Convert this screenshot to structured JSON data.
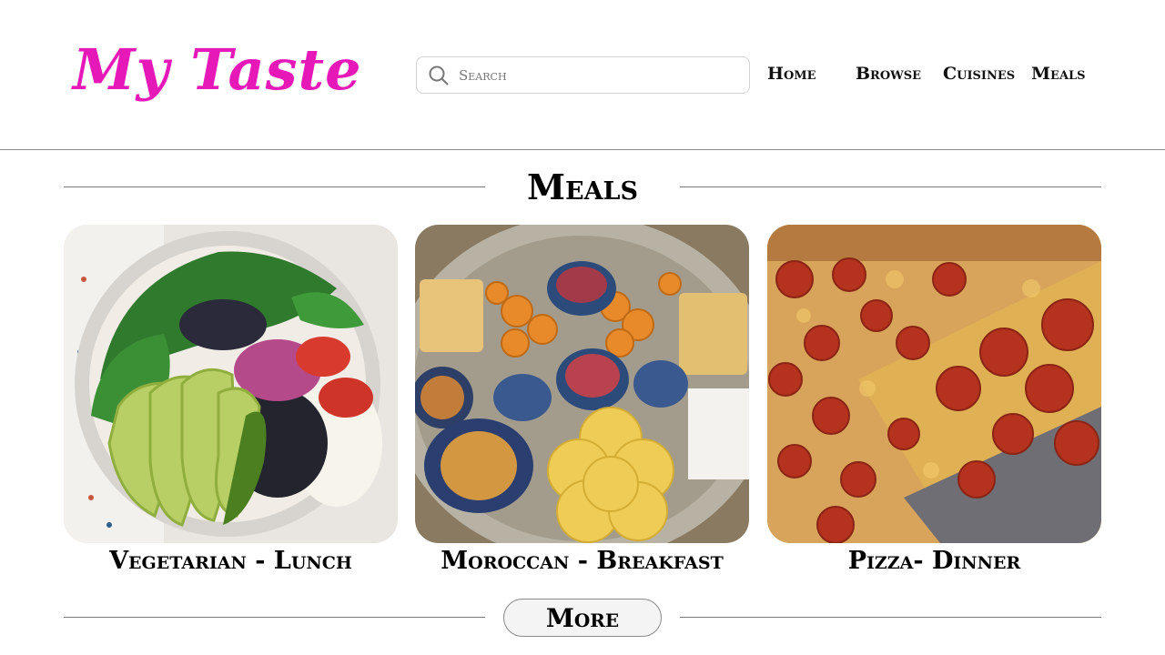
{
  "header": {
    "logo": "My Taste",
    "search": {
      "placeholder": "Search",
      "icon": "search-icon"
    },
    "nav": [
      "Home",
      "Browse",
      "Cuisines",
      "Meals"
    ]
  },
  "section": {
    "title": "Meals",
    "cards": [
      {
        "label": "Vegetarian - Lunch",
        "image": "vegetarian-bowl-image"
      },
      {
        "label": "Moroccan - Breakfast",
        "image": "moroccan-breakfast-image"
      },
      {
        "label": "Pizza- Dinner",
        "image": "pepperoni-pizza-image"
      }
    ],
    "more_label": "More"
  },
  "colors": {
    "brand": "#e619b8",
    "line": "#7a7a7a"
  }
}
